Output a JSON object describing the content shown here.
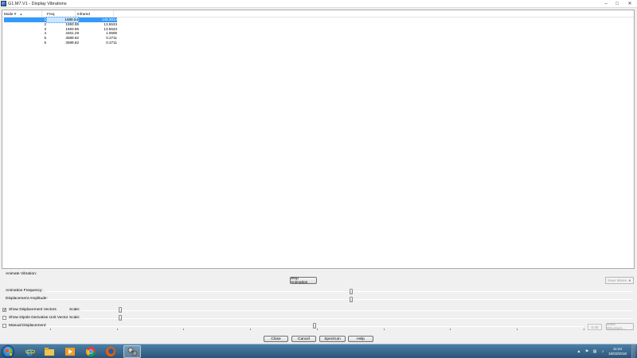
{
  "window": {
    "title": "G1.M7.V1 - Display Vibrations"
  },
  "table": {
    "headers": {
      "mode": "Mode #",
      "freq": "Freq",
      "infrared": "Infrared"
    },
    "rows": [
      {
        "mode": "1",
        "freq": "1689.54",
        "infrared": "145.3814"
      },
      {
        "mode": "2",
        "freq": "1693.95",
        "infrared": "13.5533"
      },
      {
        "mode": "3",
        "freq": "1693.95",
        "infrared": "13.5533"
      },
      {
        "mode": "4",
        "freq": "3461.29",
        "infrared": "1.0608"
      },
      {
        "mode": "5",
        "freq": "3589.82",
        "infrared": "0.2711"
      },
      {
        "mode": "6",
        "freq": "3589.82",
        "infrared": "0.2711"
      }
    ],
    "selected_row": 0
  },
  "controls": {
    "animate_vibration_label": "Animate Vibration:",
    "stop_animation_label": "Stop Animation",
    "save_movie_label": "Save Movie...",
    "animation_frequency_label": "Animation Frequency:",
    "animation_frequency_value": 0.52,
    "displacement_amplitude_label": "Displacement Amplitude:",
    "displacement_amplitude_value": 0.52,
    "show_displacement_vectors_label": "Show Displacement Vectors",
    "show_displacement_vectors_checked": true,
    "show_dipole_label": "Show Dipole Derivative Unit Vector",
    "show_dipole_checked": false,
    "scale_label": "Scale:",
    "scale1_value": 0.07,
    "scale2_value": 0.07,
    "manual_displacement_label": "Manual Displacement:",
    "manual_displacement_checked": false,
    "manual_displacement_value": 0.5,
    "manual_value_text": "0.00",
    "save_structure_label": "Save Structure..."
  },
  "buttons": {
    "close": "Close",
    "cancel": "Cancel",
    "spectrum": "Spectrum",
    "help": "Help"
  },
  "taskbar": {
    "time": "11:44",
    "date": "19/03/2018"
  },
  "colors": {
    "selection": "#3399ff",
    "taskbar": "#2b5477"
  }
}
